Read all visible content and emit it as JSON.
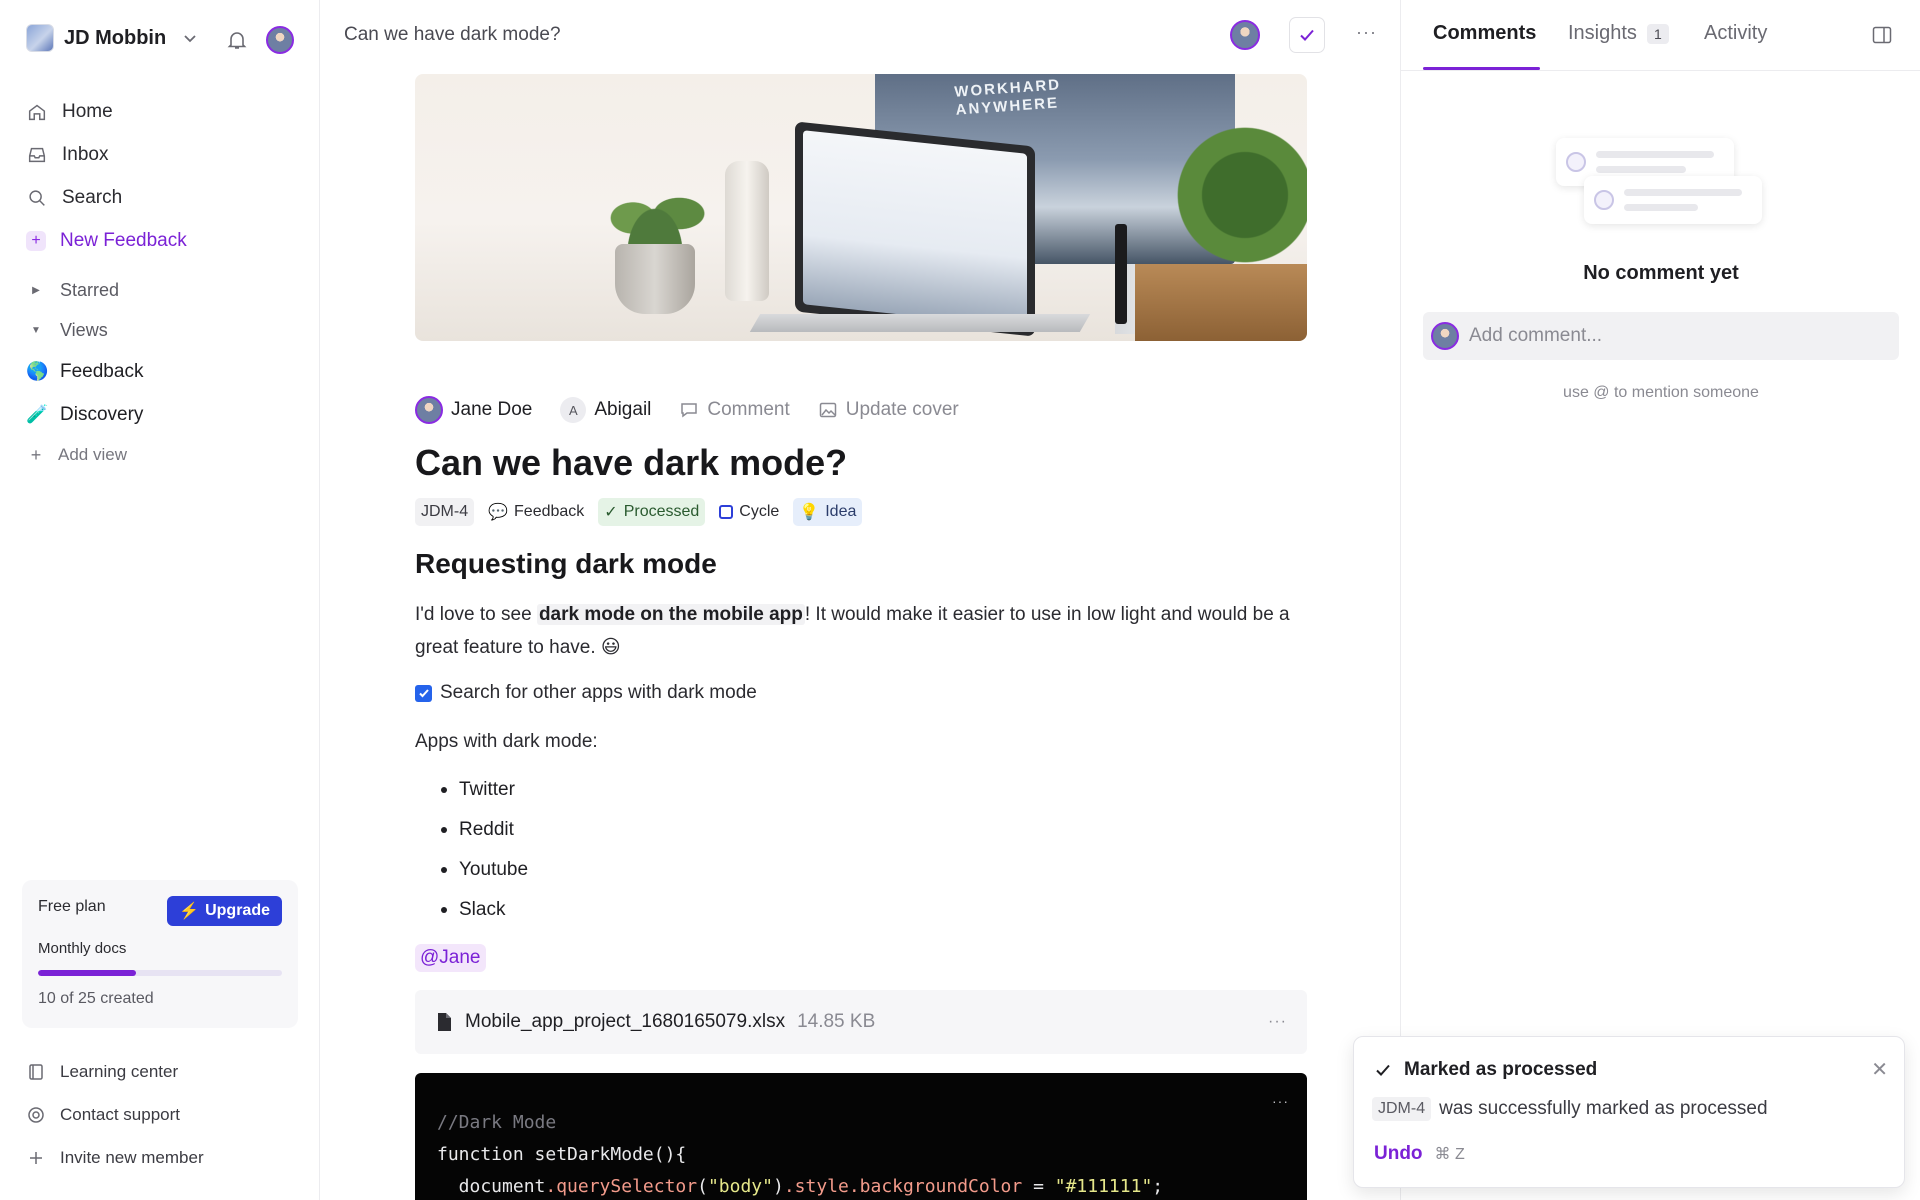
{
  "sidebar": {
    "workspace_name": "JD Mobbin",
    "nav": [
      {
        "label": "Home",
        "icon": "home-icon"
      },
      {
        "label": "Inbox",
        "icon": "inbox-icon"
      },
      {
        "label": "Search",
        "icon": "search-icon"
      },
      {
        "label": "New Feedback",
        "icon": "plus-icon"
      }
    ],
    "sections": {
      "starred": "Starred",
      "views": "Views"
    },
    "views": [
      {
        "label": "Feedback",
        "emoji": "🌎"
      },
      {
        "label": "Discovery",
        "emoji": "🧪"
      }
    ],
    "add_view": "Add view",
    "plan": {
      "title": "Free plan",
      "upgrade_label": "Upgrade",
      "subtitle": "Monthly docs",
      "count_text": "10 of 25 created",
      "progress_fraction": 0.4
    },
    "footer": [
      {
        "label": "Learning center",
        "icon": "book-icon"
      },
      {
        "label": "Contact support",
        "icon": "support-icon"
      },
      {
        "label": "Invite new member",
        "icon": "plus-icon"
      }
    ]
  },
  "topbar": {
    "title": "Can we have dark mode?",
    "more_label": "···"
  },
  "doc": {
    "author": "Jane Doe",
    "assignee": "Abigail",
    "assignee_initial": "A",
    "comment_label": "Comment",
    "update_cover_label": "Update cover",
    "cover_text_line1": "WORKHARD",
    "cover_text_line2": "ANYWHERE",
    "title": "Can we have dark mode?",
    "tags": {
      "id": "JDM-4",
      "type": "Feedback",
      "status": "Processed",
      "cycle": "Cycle",
      "label": "Idea"
    },
    "heading": "Requesting dark mode",
    "para_before": "I'd love to see ",
    "para_bold": "dark mode on the mobile app",
    "para_after": "! It would make it easier to use in low light and would be a great feature to have. 😃",
    "task": "Search for other apps with dark mode",
    "apps_label": "Apps with dark mode:",
    "apps": [
      "Twitter",
      "Reddit",
      "Youtube",
      "Slack"
    ],
    "mention": "@Jane",
    "file_name": "Mobile_app_project_1680165079.xlsx",
    "file_size": "14.85 KB",
    "code_comment": "//Dark Mode",
    "code_line2": "function setDarkMode(){",
    "code_line3_a": "  document",
    "code_line3_b": ".querySelector",
    "code_line3_c": "(",
    "code_line3_d": "\"body\"",
    "code_line3_e": ")",
    "code_line3_f": ".style.backgroundColor",
    "code_line3_g": " = ",
    "code_line3_h": "\"#111111\"",
    "code_line3_i": ";"
  },
  "panel": {
    "tabs": [
      {
        "label": "Comments",
        "active": true
      },
      {
        "label": "Insights",
        "badge": "1"
      },
      {
        "label": "Activity"
      }
    ],
    "empty_text": "No comment yet",
    "comment_placeholder": "Add comment...",
    "mention_hint": "use @ to mention someone"
  },
  "toast": {
    "title": "Marked as processed",
    "id": "JDM-4",
    "message": "was successfully marked as processed",
    "undo_label": "Undo",
    "shortcut": "⌘ Z"
  },
  "colors": {
    "accent": "#7B22D6",
    "upgrade": "#2D3FD8",
    "processed_bg": "#E5F3E6"
  }
}
